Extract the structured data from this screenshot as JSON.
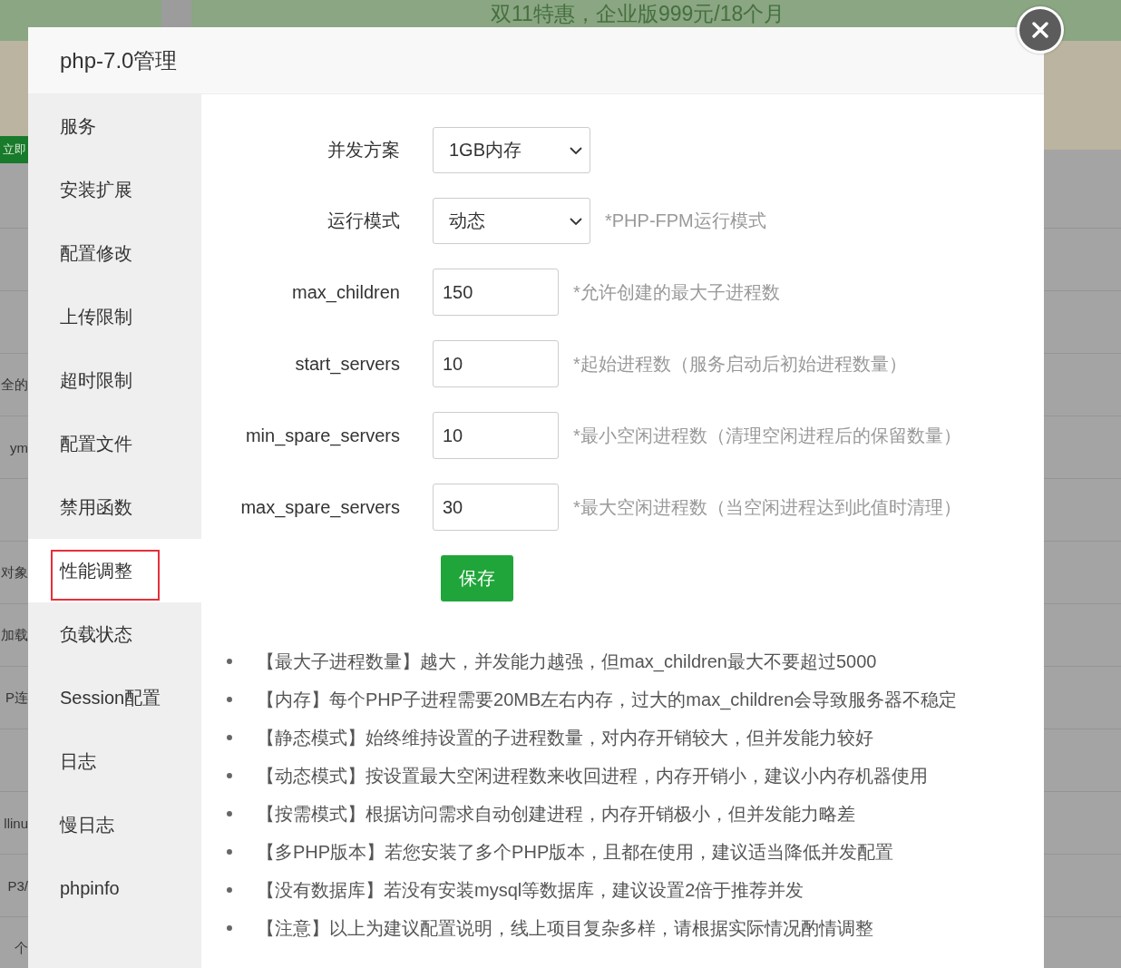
{
  "background": {
    "banner": {
      "text": "双11特惠，企业版999元/18个月"
    },
    "notice_button": {
      "label": "立即"
    },
    "rows": [
      {
        "text": "全的"
      },
      {
        "text": "ym"
      },
      {
        "text": "对象"
      },
      {
        "text": "加载"
      },
      {
        "text": "P连"
      },
      {
        "text": "llinu"
      },
      {
        "text": "P3/"
      },
      {
        "text": "个"
      }
    ]
  },
  "dialog": {
    "title": "php-7.0管理"
  },
  "sidebar": {
    "items": [
      {
        "label": "服务",
        "selected": false,
        "highlighted": false
      },
      {
        "label": "安装扩展",
        "selected": false,
        "highlighted": false
      },
      {
        "label": "配置修改",
        "selected": false,
        "highlighted": false
      },
      {
        "label": "上传限制",
        "selected": false,
        "highlighted": false
      },
      {
        "label": "超时限制",
        "selected": false,
        "highlighted": false
      },
      {
        "label": "配置文件",
        "selected": false,
        "highlighted": false
      },
      {
        "label": "禁用函数",
        "selected": false,
        "highlighted": false
      },
      {
        "label": "性能调整",
        "selected": true,
        "highlighted": true
      },
      {
        "label": "负载状态",
        "selected": false,
        "highlighted": false
      },
      {
        "label": "Session配置",
        "selected": false,
        "highlighted": false
      },
      {
        "label": "日志",
        "selected": false,
        "highlighted": false
      },
      {
        "label": "慢日志",
        "selected": false,
        "highlighted": false
      },
      {
        "label": "phpinfo",
        "selected": false,
        "highlighted": false
      }
    ]
  },
  "form": {
    "fields": [
      {
        "kind": "select",
        "label": "并发方案",
        "value": "1GB内存"
      },
      {
        "kind": "select",
        "label": "运行模式",
        "value": "动态",
        "hint": "*PHP-FPM运行模式"
      },
      {
        "kind": "input",
        "label": "max_children",
        "value": "150",
        "hint": "*允许创建的最大子进程数"
      },
      {
        "kind": "input",
        "label": "start_servers",
        "value": "10",
        "hint": "*起始进程数（服务启动后初始进程数量）"
      },
      {
        "kind": "input",
        "label": "min_spare_servers",
        "value": "10",
        "hint": "*最小空闲进程数（清理空闲进程后的保留数量）"
      },
      {
        "kind": "input",
        "label": "max_spare_servers",
        "value": "30",
        "hint": "*最大空闲进程数（当空闲进程达到此值时清理）"
      }
    ],
    "save_button": {
      "label": "保存"
    }
  },
  "notes": [
    "【最大子进程数量】越大，并发能力越强，但max_children最大不要超过5000",
    "【内存】每个PHP子进程需要20MB左右内存，过大的max_children会导致服务器不稳定",
    "【静态模式】始终维持设置的子进程数量，对内存开销较大，但并发能力较好",
    "【动态模式】按设置最大空闲进程数来收回进程，内存开销小，建议小内存机器使用",
    "【按需模式】根据访问需求自动创建进程，内存开销极小，但并发能力略差",
    "【多PHP版本】若您安装了多个PHP版本，且都在使用，建议适当降低并发配置",
    "【没有数据库】若没有安装mysql等数据库，建议设置2倍于推荐并发",
    "【注意】以上为建议配置说明，线上项目复杂多样，请根据实际情况酌情调整"
  ]
}
